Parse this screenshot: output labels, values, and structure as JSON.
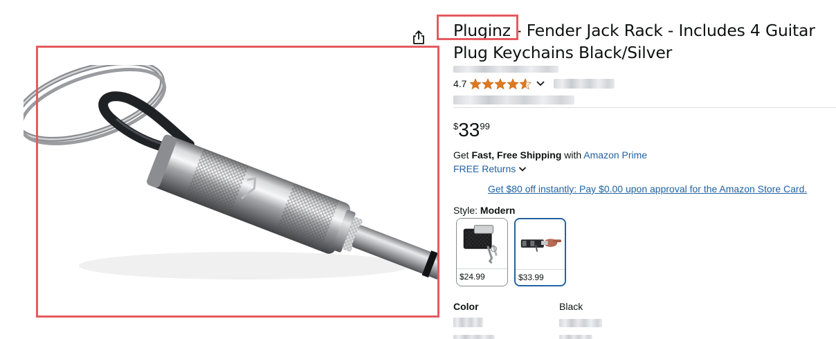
{
  "product": {
    "title": "Pluginz - Fender Jack Rack - Includes 4 Guitar Plug Keychains Black/Silver",
    "rating": "4.7",
    "rating_value": 4.7,
    "rating_max": 5,
    "price": {
      "symbol": "$",
      "whole": "33",
      "fraction": "99"
    },
    "shipping": {
      "prefix": "Get ",
      "bold": "Fast, Free Shipping",
      "middle": " with ",
      "link": "Amazon Prime"
    },
    "returns": "FREE Returns",
    "promo": "Get $80 off instantly: Pay $0.00 upon approval for the Amazon Store Card.",
    "style": {
      "label": "Style: ",
      "selected": "Modern",
      "options": [
        {
          "price": "$24.99",
          "selected": false
        },
        {
          "price": "$33.99",
          "selected": true
        }
      ]
    },
    "specs": [
      {
        "key": "Color",
        "value": "Black"
      }
    ]
  },
  "colors": {
    "link": "#2162a1",
    "star": "#de7921",
    "highlight": "#e55a5f",
    "selected_border": "#2162a1"
  },
  "icons": [
    "share-icon",
    "star-icon",
    "chevron-down-icon"
  ]
}
